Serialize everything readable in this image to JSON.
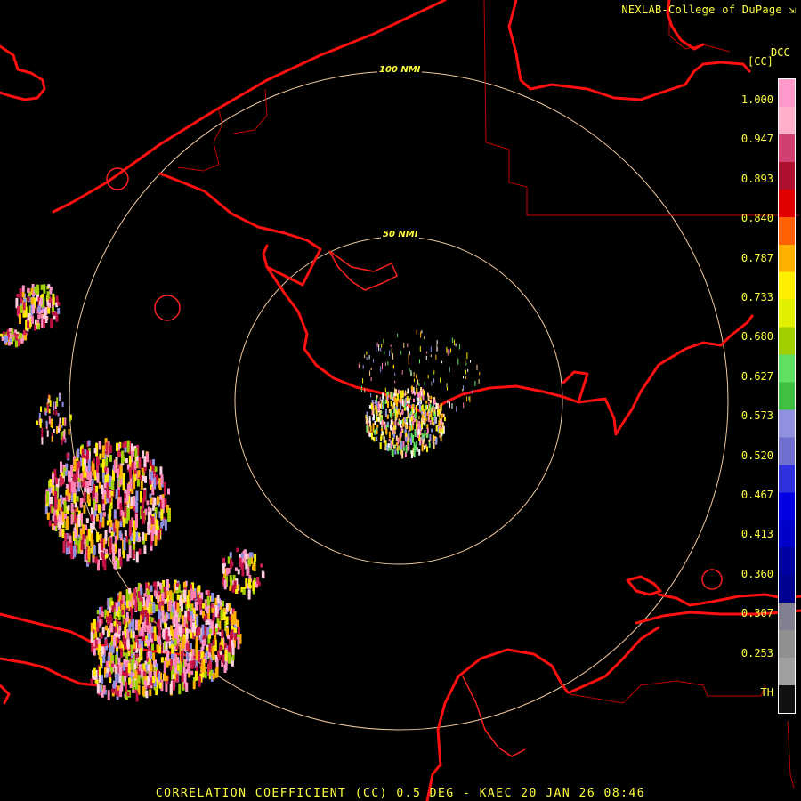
{
  "header": {
    "credit": "NEXLAB-College of DuPage ⇲"
  },
  "legend": {
    "product_code": "DCC",
    "unit": "[CC]",
    "labels": [
      "1.000",
      "0.947",
      "0.893",
      "0.840",
      "0.787",
      "0.733",
      "0.680",
      "0.627",
      "0.573",
      "0.520",
      "0.467",
      "0.413",
      "0.360",
      "0.307",
      "0.253",
      "TH"
    ],
    "colors": [
      "#ff99cc",
      "#ffb0c8",
      "#d04070",
      "#b01030",
      "#e00000",
      "#ff6000",
      "#ffb000",
      "#ffee00",
      "#e0f000",
      "#a0d000",
      "#60e060",
      "#40c040",
      "#9090e0",
      "#7070d0",
      "#3030e0",
      "#0000e0",
      "#0000c8",
      "#0000a0",
      "#000090",
      "#808090",
      "#909090",
      "#a0a0a0",
      "#101010"
    ]
  },
  "map": {
    "ring_labels": [
      "100 NMI",
      "50 NMI"
    ]
  },
  "footer": {
    "title": "CORRELATION COEFFICIENT (CC) 0.5 DEG - KAEC 20 JAN 26 08:46"
  }
}
